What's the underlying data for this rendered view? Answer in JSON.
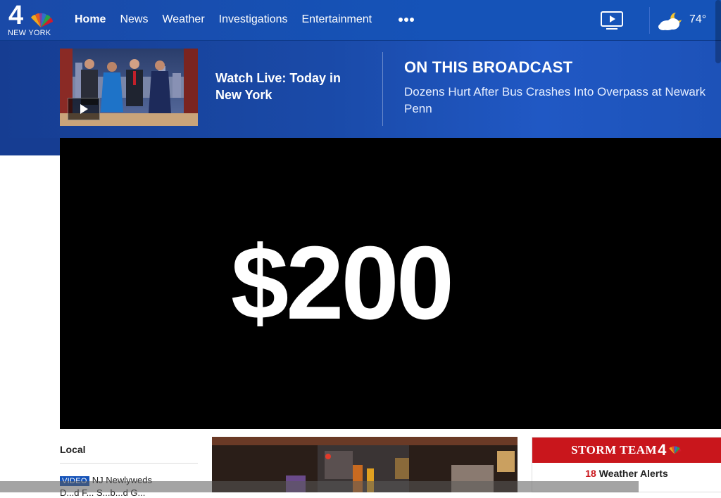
{
  "header": {
    "logo_text": "NEW YORK",
    "logo_number": "4",
    "nav": [
      {
        "label": "Home"
      },
      {
        "label": "News"
      },
      {
        "label": "Weather"
      },
      {
        "label": "Investigations"
      },
      {
        "label": "Entertainment"
      }
    ],
    "temperature": "74°"
  },
  "broadcast": {
    "watch_live_title": "Watch Live: Today in New York",
    "heading": "ON THIS BROADCAST",
    "story": "Dozens Hurt After Bus Crashes Into Overpass at Newark Penn"
  },
  "hero": {
    "amount": "$200"
  },
  "local": {
    "heading": "Local",
    "badge": "VIDEO",
    "item_title": "NJ Newlyweds",
    "item_sub": "D...d F... S...b...d G..."
  },
  "storm": {
    "title": "STORM TEAM",
    "title_number": "4",
    "alerts_count": "18",
    "alerts_label": "Weather Alerts"
  },
  "colors": {
    "nav_blue": "#1553b8",
    "storm_red": "#c9161c"
  }
}
